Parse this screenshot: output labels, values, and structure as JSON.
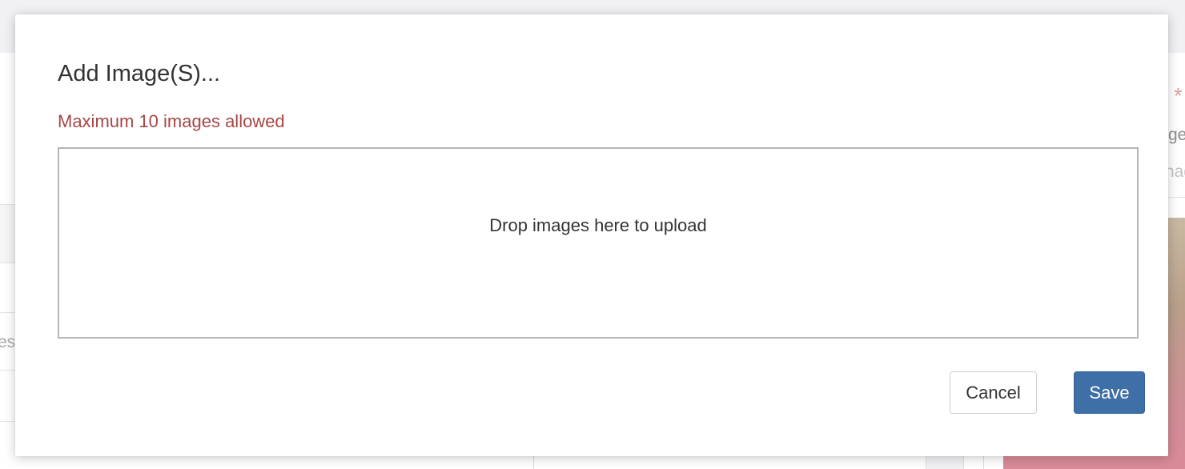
{
  "modal": {
    "title": "Add Image(S)...",
    "warning": "Maximum 10 images allowed",
    "dropzone_text": "Drop images here to upload",
    "cancel_label": "Cancel",
    "save_label": "Save"
  },
  "background": {
    "left_fragment": "es",
    "right_asterisk": "*",
    "right_fragment_1": "ge",
    "right_fragment_2": "nag"
  },
  "colors": {
    "warning_text": "#a84646",
    "save_button": "#3e6fa6",
    "dropzone_border": "#b5b5b5"
  }
}
